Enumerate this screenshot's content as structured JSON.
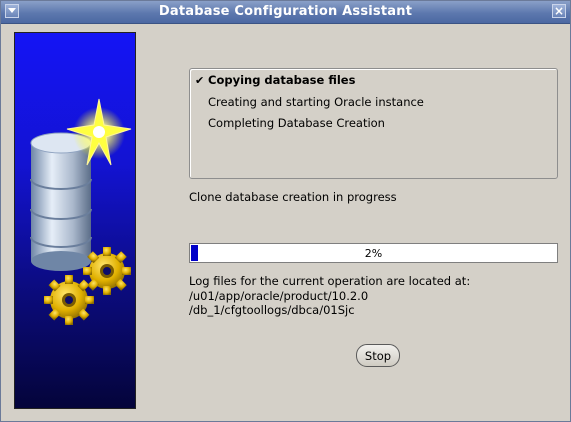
{
  "window": {
    "title": "Database Configuration Assistant",
    "close_glyph": "×"
  },
  "steps": [
    {
      "label": "Copying database files",
      "done": true,
      "check": "✔"
    },
    {
      "label": "Creating and starting Oracle instance",
      "done": false
    },
    {
      "label": "Completing Database Creation",
      "done": false
    }
  ],
  "status_text": "Clone database creation in progress",
  "progress": {
    "percent": 2,
    "label": "2%",
    "fill_color": "#0000c8"
  },
  "log": {
    "line1": "Log files for the current operation are located at:",
    "line2": "/u01/app/oracle/product/10.2.0",
    "line3": "/db_1/cfgtoollogs/dbca/01Sjc"
  },
  "buttons": {
    "stop": "Stop"
  },
  "icons": {
    "banner": [
      "database-cylinder-icon",
      "star-burst-icon",
      "gear-icon",
      "gear-icon"
    ]
  }
}
